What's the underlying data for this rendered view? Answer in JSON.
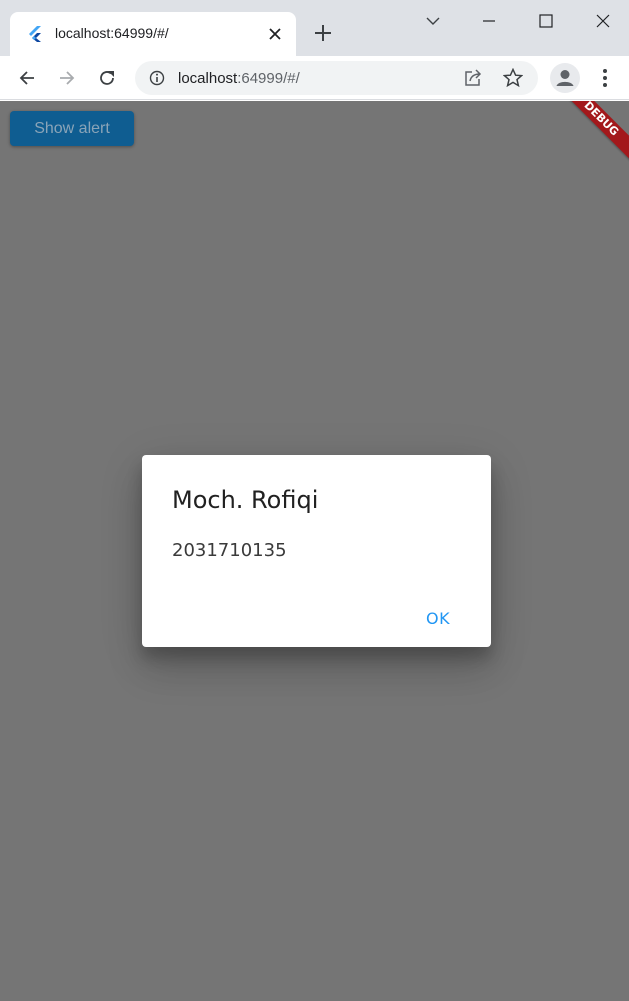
{
  "browser": {
    "tab": {
      "title": "localhost:64999/#/",
      "favicon": "flutter-icon"
    },
    "window_controls": [
      "chevron-down-icon",
      "minimize-icon",
      "maximize-icon",
      "close-icon"
    ],
    "omnibox": {
      "host": "localhost",
      "path": ":64999/#/"
    }
  },
  "page": {
    "background": "#757575",
    "show_alert_label": "Show alert",
    "debug_banner": "DEBUG",
    "dialog": {
      "title": "Moch. Rofiqi",
      "content": "2031710135",
      "ok_label": "OK"
    }
  },
  "colors": {
    "accent": "#2196f3",
    "button": "#0f5d91",
    "debug": "#a3181b"
  }
}
